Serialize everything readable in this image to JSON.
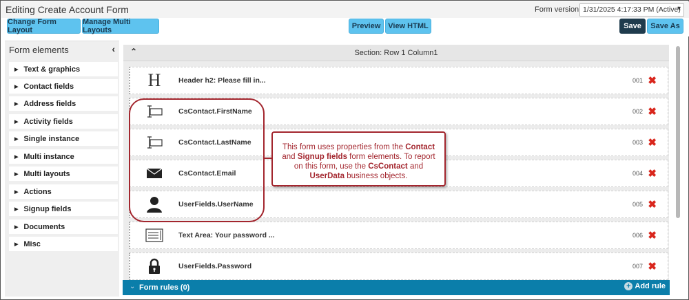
{
  "window": {
    "title": "Editing Create Account Form"
  },
  "form_version": {
    "label": "Form version",
    "value": "1/31/2025 4:17:33 PM (Active)"
  },
  "toolbar": {
    "change_layout": "Change Form Layout",
    "manage_multi": "Manage Multi Layouts",
    "preview": "Preview",
    "view_html": "View HTML",
    "save": "Save",
    "save_as": "Save As"
  },
  "sidebar": {
    "heading": "Form elements",
    "items": [
      "Text & graphics",
      "Contact fields",
      "Address fields",
      "Activity fields",
      "Single instance",
      "Multi instance",
      "Multi layouts",
      "Actions",
      "Signup fields",
      "Documents",
      "Misc"
    ]
  },
  "section": {
    "title": "Section: Row 1 Column1"
  },
  "rows": [
    {
      "icon": "header-icon",
      "glyph": "H",
      "label": "Header h2: Please fill in...",
      "num": "001"
    },
    {
      "icon": "text-input-icon",
      "label": "CsContact.FirstName",
      "num": "002"
    },
    {
      "icon": "text-input-icon",
      "label": "CsContact.LastName",
      "num": "003"
    },
    {
      "icon": "envelope-icon",
      "label": "CsContact.Email",
      "num": "004"
    },
    {
      "icon": "user-icon",
      "label": "UserFields.UserName",
      "num": "005"
    },
    {
      "icon": "textarea-icon",
      "label": "Text Area: Your password ...",
      "num": "006"
    },
    {
      "icon": "lock-icon",
      "label": "UserFields.Password",
      "num": "007"
    }
  ],
  "form_rules": {
    "label": "Form rules (0)",
    "add": "Add rule"
  },
  "callout": {
    "p1": "This form uses properties from the ",
    "b1": "Contact",
    "p2": " and ",
    "b2": "Signup fields",
    "p3": " form elements. To report on this form, use the ",
    "b3": "CsContact",
    "p4": " and ",
    "b4": "UserData",
    "p5": " business objects."
  },
  "colors": {
    "accent": "#5ec3ef",
    "dark_button": "#1f3b4d",
    "rules_bar": "#0b7eaa",
    "callout": "#a3262e",
    "delete": "#d9261c"
  }
}
